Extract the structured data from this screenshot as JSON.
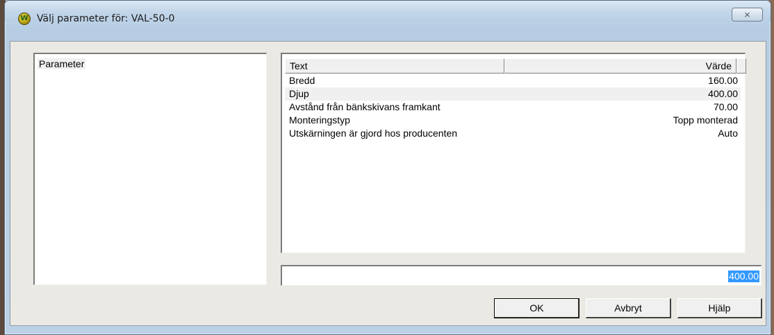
{
  "window": {
    "title": "Välj parameter för: VAL-50-0",
    "close_label": "⨯"
  },
  "left_panel": {
    "header": "Parameter"
  },
  "table": {
    "columns": [
      "Text",
      "Värde"
    ],
    "rows": [
      {
        "text": "Bredd",
        "value": "160.00",
        "selected": false
      },
      {
        "text": "Djup",
        "value": "400.00",
        "selected": true
      },
      {
        "text": "Avstånd från bänkskivans framkant",
        "value": "70.00",
        "selected": false
      },
      {
        "text": "Monteringstyp",
        "value": "Topp monterad",
        "selected": false
      },
      {
        "text": "Utskärningen är gjord hos producenten",
        "value": "Auto",
        "selected": false
      }
    ]
  },
  "edit": {
    "value": "400.00"
  },
  "buttons": {
    "ok": "OK",
    "cancel": "Avbryt",
    "help": "Hjälp"
  },
  "colors": {
    "selection": "#3399ff",
    "row_highlight": "#f0f0f0"
  },
  "icons": {
    "app": "app-logo-icon",
    "close": "close-icon"
  }
}
